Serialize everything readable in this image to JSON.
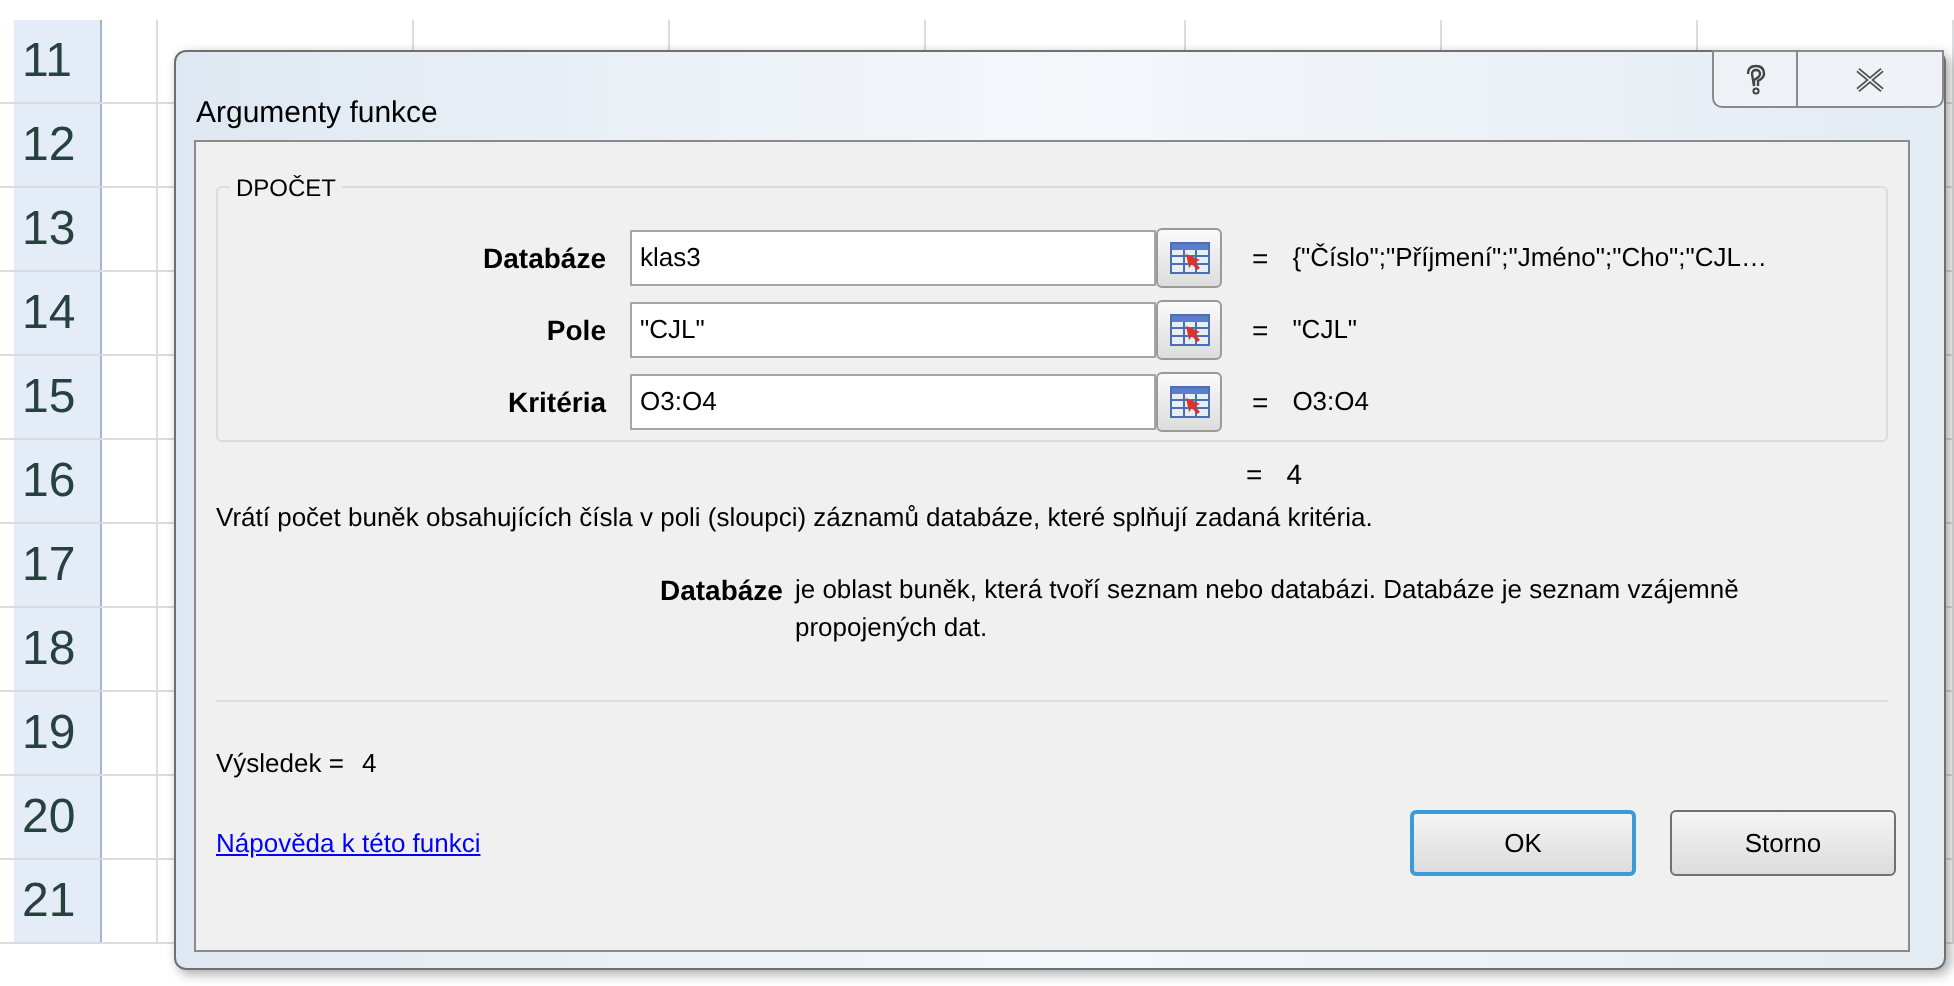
{
  "spreadsheet": {
    "row_headers": [
      "11",
      "12",
      "13",
      "14",
      "15",
      "16",
      "17",
      "18",
      "19",
      "20",
      "21"
    ]
  },
  "dialog": {
    "title": "Argumenty funkce",
    "group": "DPOČET",
    "arguments": [
      {
        "label": "Databáze",
        "value": "klas3",
        "equals": "=",
        "result": "{\"Číslo\";\"Příjmení\";\"Jméno\";\"Cho\";\"CJL…"
      },
      {
        "label": "Pole",
        "value": "\"CJL\"",
        "equals": "=",
        "result": "\"CJL\""
      },
      {
        "label": "Kritéria",
        "value": "O3:O4",
        "equals": "=",
        "result": "O3:O4"
      }
    ],
    "formula_result": {
      "equals": "=",
      "value": "4"
    },
    "description": "Vrátí počet buněk obsahujících čísla v poli (sloupci) záznamů databáze, které splňují zadaná kritéria.",
    "argument_help": {
      "name": "Databáze",
      "text": "je oblast buněk, která tvoří seznam nebo databázi. Databáze je seznam vzájemně propojených dat."
    },
    "result": {
      "label": "Výsledek =",
      "value": "4"
    },
    "help_link": "Nápověda k této funkci",
    "buttons": [
      {
        "label": "OK",
        "default": true
      },
      {
        "label": "Storno",
        "default": false
      }
    ]
  }
}
